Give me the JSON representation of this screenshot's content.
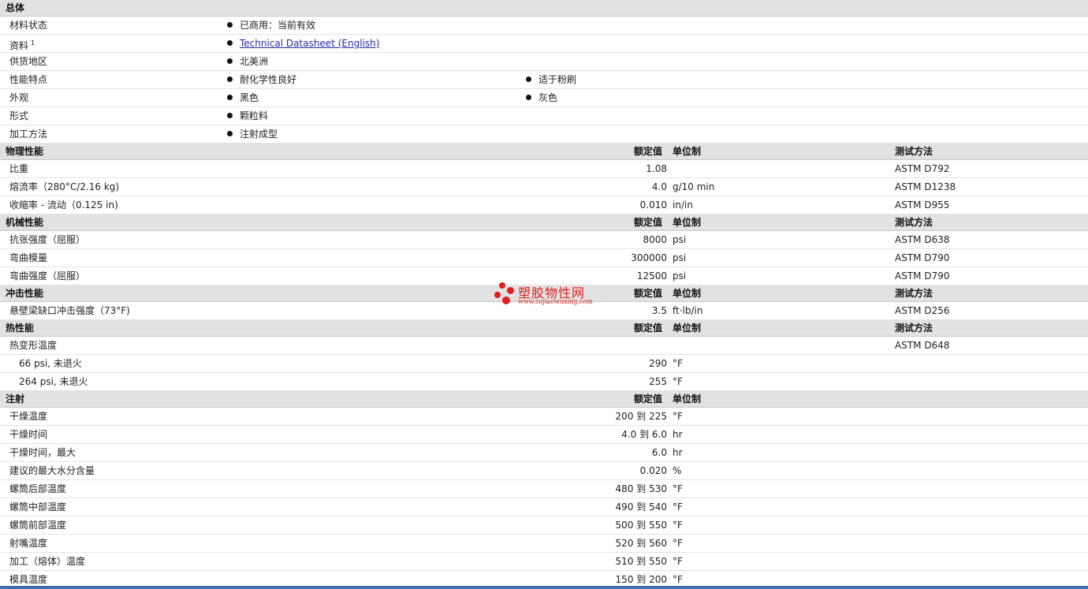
{
  "sections": {
    "general": {
      "title": "总体",
      "rows": [
        {
          "label": "材料状态",
          "items": [
            "已商用：当前有效"
          ]
        },
        {
          "label": "资料",
          "sup": "1",
          "link": "Technical Datasheet (English)"
        },
        {
          "label": "供货地区",
          "items": [
            "北美洲"
          ]
        },
        {
          "label": "性能特点",
          "items": [
            "耐化学性良好",
            "适于粉刷"
          ]
        },
        {
          "label": "外观",
          "items": [
            "黑色",
            "灰色"
          ]
        },
        {
          "label": "形式",
          "items": [
            "颗粒料"
          ]
        },
        {
          "label": "加工方法",
          "items": [
            "注射成型"
          ]
        }
      ]
    },
    "physical": {
      "title": "物理性能",
      "nominal": "额定值",
      "unit": "单位制",
      "test": "测试方法",
      "rows": [
        {
          "label": "比重",
          "value": "1.08",
          "unit": "",
          "test": "ASTM D792"
        },
        {
          "label": "熔流率（280°C/2.16 kg)",
          "value": "4.0",
          "unit": "g/10 min",
          "test": "ASTM D1238"
        },
        {
          "label": "收缩率 - 流动（0.125 in)",
          "value": "0.010",
          "unit": "in/in",
          "test": "ASTM D955"
        }
      ]
    },
    "mechanical": {
      "title": "机械性能",
      "nominal": "额定值",
      "unit": "单位制",
      "test": "测试方法",
      "rows": [
        {
          "label": "抗张强度（屈服）",
          "value": "8000",
          "unit": "psi",
          "test": "ASTM D638"
        },
        {
          "label": "弯曲模量",
          "value": "300000",
          "unit": "psi",
          "test": "ASTM D790"
        },
        {
          "label": "弯曲强度（屈服）",
          "value": "12500",
          "unit": "psi",
          "test": "ASTM D790"
        }
      ]
    },
    "impact": {
      "title": "冲击性能",
      "nominal": "额定值",
      "unit": "单位制",
      "test": "测试方法",
      "rows": [
        {
          "label": "悬壁梁缺口冲击强度（73°F)",
          "value": "3.5",
          "unit": "ft·lb/in",
          "test": "ASTM D256"
        }
      ]
    },
    "thermal": {
      "title": "热性能",
      "nominal": "额定值",
      "unit": "单位制",
      "test": "测试方法",
      "rows": [
        {
          "label": "热变形温度",
          "value": "",
          "unit": "",
          "test": "ASTM D648"
        },
        {
          "label": "66 psi, 未退火",
          "value": "290",
          "unit": "°F",
          "test": "",
          "sub": true
        },
        {
          "label": "264 psi, 未退火",
          "value": "255",
          "unit": "°F",
          "test": "",
          "sub": true
        }
      ]
    },
    "injection": {
      "title": "注射",
      "nominal": "额定值",
      "unit": "单位制",
      "rows": [
        {
          "label": "干燥温度",
          "value": "200 到  225",
          "unit": "°F"
        },
        {
          "label": "干燥时间",
          "value": "4.0 到  6.0",
          "unit": "hr"
        },
        {
          "label": "干燥时间，最大",
          "value": "6.0",
          "unit": "hr"
        },
        {
          "label": "建议的最大水分含量",
          "value": "0.020",
          "unit": "%"
        },
        {
          "label": "螺筒后部温度",
          "value": "480 到  530",
          "unit": "°F"
        },
        {
          "label": "螺筒中部温度",
          "value": "490 到  540",
          "unit": "°F"
        },
        {
          "label": "螺筒前部温度",
          "value": "500 到  550",
          "unit": "°F"
        },
        {
          "label": "射嘴温度",
          "value": "520 到  560",
          "unit": "°F"
        },
        {
          "label": "加工（熔体）温度",
          "value": "510 到  550",
          "unit": "°F"
        },
        {
          "label": "模具温度",
          "value": "150 到  200",
          "unit": "°F"
        }
      ]
    }
  },
  "watermark": {
    "name": "塑胶物性网",
    "url": "www.sujiaowuxing.com"
  },
  "colors": {
    "header_bg": "#e2e2e2",
    "link": "#2a2aa8",
    "watermark": "#e21d1d",
    "bottom_bar": "#3f6fa8"
  }
}
